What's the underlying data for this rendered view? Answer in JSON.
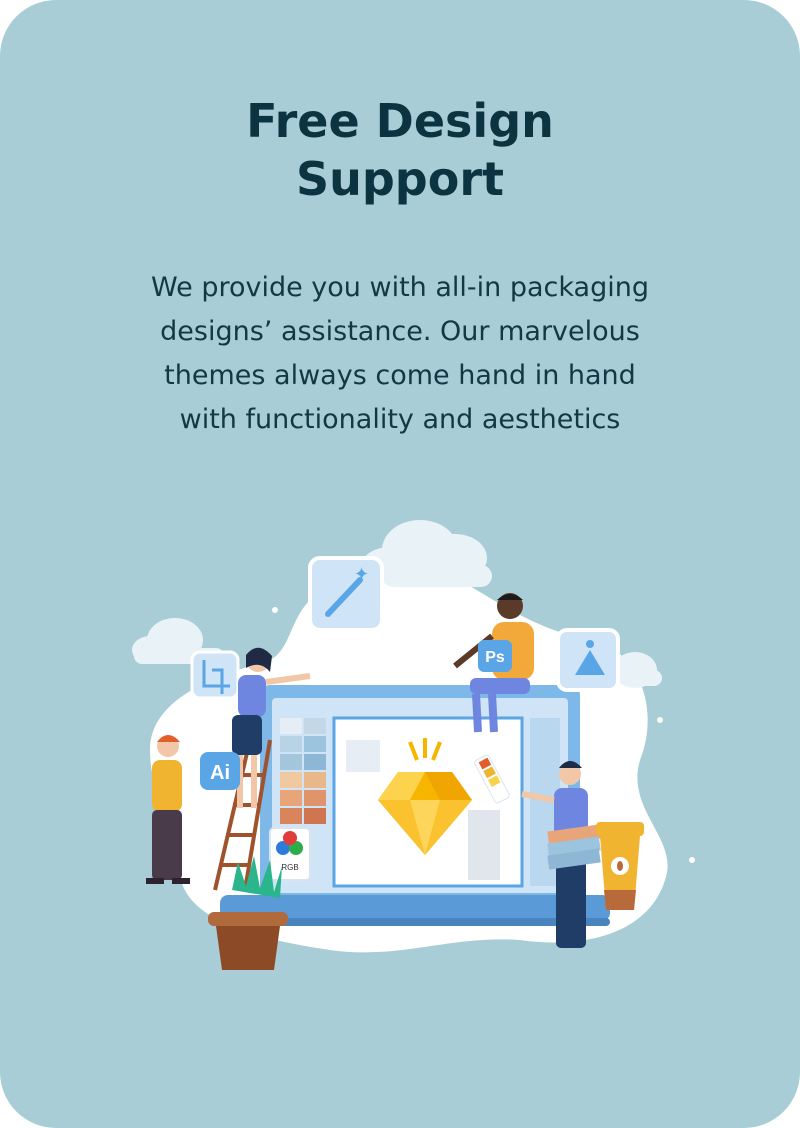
{
  "card": {
    "title_line1": "Free Design",
    "title_line2": "Support",
    "description_lines": [
      "We provide you with all-in packaging",
      "designs’ assistance. Our marvelous",
      "themes always come hand in hand",
      "with functionality and aesthetics"
    ]
  },
  "illustration": {
    "ai_badge": "Ai",
    "ps_badge": "Ps",
    "rgb_label": "RGB",
    "icons": [
      "magic-wand-icon",
      "crop-icon",
      "pen-tool-icon",
      "sketch-diamond-icon"
    ]
  },
  "colors": {
    "background": "#a8cdd6",
    "title": "#0b3340",
    "text": "#123846",
    "accent_blue": "#5aa5e6",
    "diamond": "#f7b500"
  }
}
